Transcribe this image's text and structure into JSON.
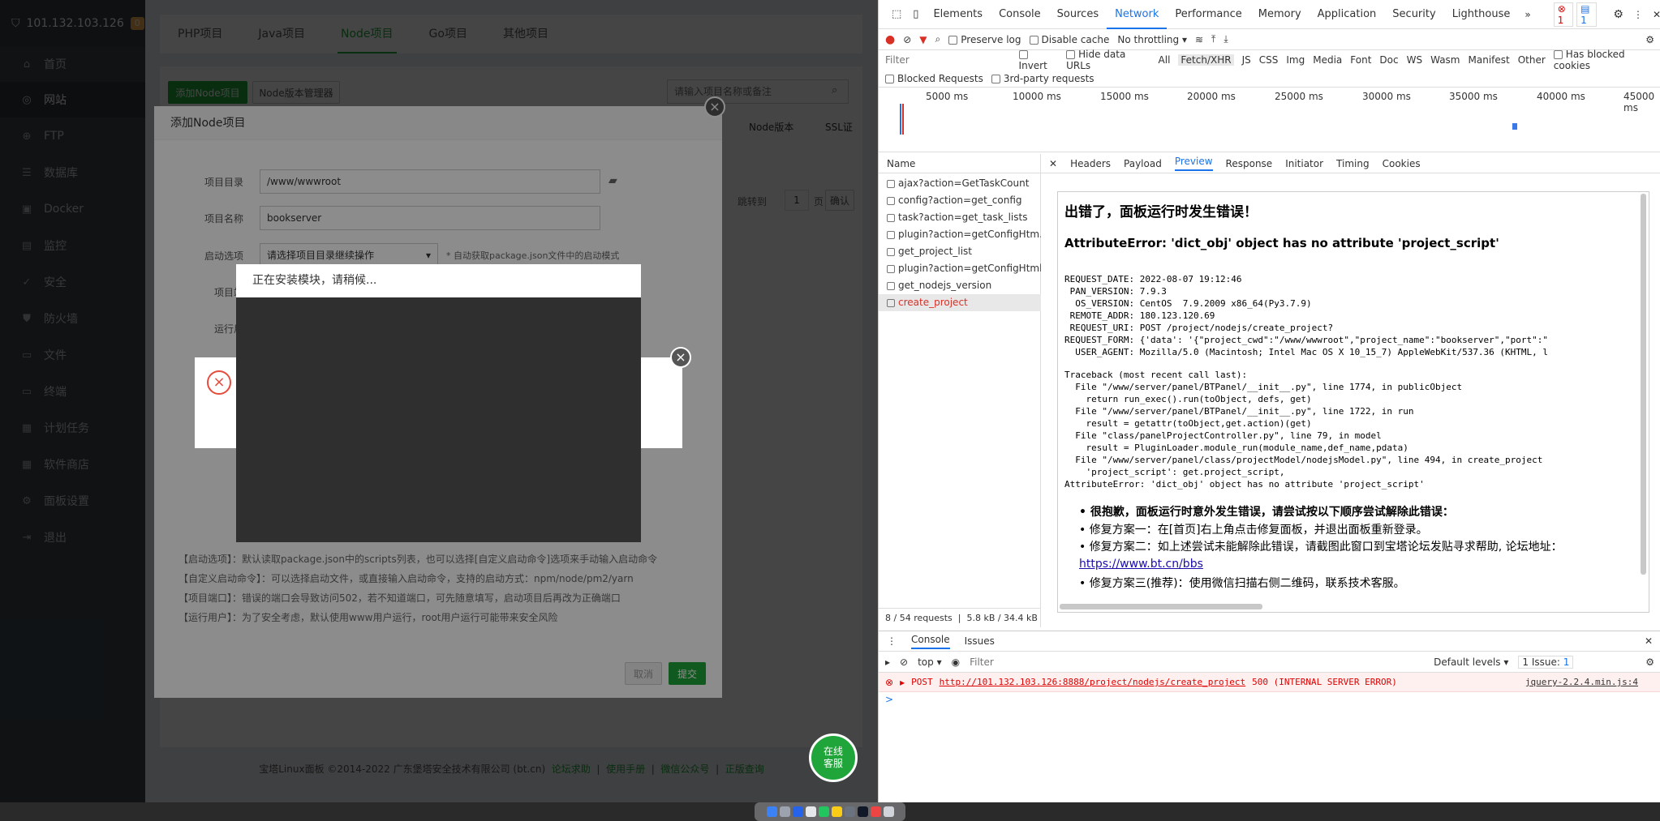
{
  "sidebar": {
    "server_ip": "101.132.103.126",
    "badge_count": "0",
    "items": [
      {
        "label": "首页",
        "icon": "home-icon"
      },
      {
        "label": "网站",
        "icon": "globe-icon",
        "active": true
      },
      {
        "label": "FTP",
        "icon": "ftp-icon"
      },
      {
        "label": "数据库",
        "icon": "database-icon"
      },
      {
        "label": "Docker",
        "icon": "docker-icon"
      },
      {
        "label": "监控",
        "icon": "monitor-icon"
      },
      {
        "label": "安全",
        "icon": "shield-icon"
      },
      {
        "label": "防火墙",
        "icon": "firewall-icon"
      },
      {
        "label": "文件",
        "icon": "folder-icon"
      },
      {
        "label": "终端",
        "icon": "terminal-icon"
      },
      {
        "label": "计划任务",
        "icon": "calendar-icon"
      },
      {
        "label": "软件商店",
        "icon": "grid-icon"
      },
      {
        "label": "面板设置",
        "icon": "settings-icon"
      },
      {
        "label": "退出",
        "icon": "logout-icon"
      }
    ]
  },
  "project_tabs": [
    "PHP项目",
    "Java项目",
    "Node项目",
    "Go项目",
    "其他项目"
  ],
  "toolbar": {
    "add_node": "添加Node项目",
    "node_version_mgr": "Node版本管理器",
    "search_placeholder": "请输入项目名称或备注"
  },
  "table_headers": {
    "node_version": "Node版本",
    "ssl": "SSL证"
  },
  "pagination": {
    "jump_to": "跳转到",
    "page_num": "1",
    "page_unit": "页",
    "confirm": "确认"
  },
  "dialog": {
    "title": "添加Node项目",
    "fields": {
      "dir_label": "项目目录",
      "dir_value": "/www/wwwroot",
      "name_label": "项目名称",
      "name_value": "bookserver",
      "start_label": "启动选项",
      "start_value": "请选择项目目录继续操作",
      "start_hint": "* 自动获取package.json文件中的启动模式",
      "port_label": "项目端",
      "user_label": "运行用"
    },
    "hints": [
      "【启动选项】：默认读取package.json中的scripts列表，也可以选择[自定义启动命令]选项来手动输入启动命令",
      "【自定义启动命令】：可以选择启动文件，或直接输入启动命令，支持的启动方式：npm/node/pm2/yarn",
      "【项目端口】：错误的端口会导致访问502，若不知道端口，可先随意填写，启动项目后再改为正确端口",
      "【运行用户】：为了安全考虑，默认使用www用户运行，root用户运行可能带来安全风险"
    ],
    "cancel": "取消",
    "submit": "提交"
  },
  "loader": {
    "message": "正在安装模块，请稍候..."
  },
  "chat_button": "在线\n客服",
  "footer": {
    "copyright": "宝塔Linux面板 ©2014-2022 广东堡塔安全技术有限公司 (bt.cn)",
    "links": [
      "论坛求助",
      "使用手册",
      "微信公众号",
      "正版查询"
    ]
  },
  "devtools": {
    "tabs": [
      "Elements",
      "Console",
      "Sources",
      "Network",
      "Performance",
      "Memory",
      "Application",
      "Security",
      "Lighthouse"
    ],
    "active_tab": "Network",
    "error_badge": "1",
    "info_badge": "1",
    "toolbar": {
      "preserve_log": "Preserve log",
      "disable_cache": "Disable cache",
      "throttling": "No throttling"
    },
    "filter_placeholder": "Filter",
    "filter_types": [
      "Invert",
      "Hide data URLs",
      "All",
      "Fetch/XHR",
      "JS",
      "CSS",
      "Img",
      "Media",
      "Font",
      "Doc",
      "WS",
      "Wasm",
      "Manifest",
      "Other",
      "Has blocked cookies"
    ],
    "blocked_requests": "Blocked Requests",
    "third_party": "3rd-party requests",
    "timeline_ticks": [
      "5000 ms",
      "10000 ms",
      "15000 ms",
      "20000 ms",
      "25000 ms",
      "30000 ms",
      "35000 ms",
      "40000 ms",
      "45000 ms"
    ],
    "name_header": "Name",
    "requests": [
      "ajax?action=GetTaskCount",
      "config?action=get_config",
      "task?action=get_task_lists",
      "plugin?action=getConfigHtm...",
      "get_project_list",
      "plugin?action=getConfigHtml",
      "get_nodejs_version",
      "create_project"
    ],
    "detail_tabs": [
      "Headers",
      "Payload",
      "Preview",
      "Response",
      "Initiator",
      "Timing",
      "Cookies"
    ],
    "active_detail": "Preview",
    "summary_requests": "8 / 54 requests",
    "summary_size": "5.8 kB / 34.4 kB"
  },
  "preview": {
    "title": "出错了，面板运行时发生错误！",
    "error": "AttributeError: 'dict_obj' object has no attribute 'project_script'",
    "details": "REQUEST_DATE: 2022-08-07 19:12:46\n PAN_VERSION: 7.9.3\n  OS_VERSION: CentOS  7.9.2009 x86_64(Py3.7.9)\n REMOTE_ADDR: 180.123.120.69\n REQUEST_URI: POST /project/nodejs/create_project?\nREQUEST_FORM: {'data': '{\"project_cwd\":\"/www/wwwroot\",\"project_name\":\"bookserver\",\"port\":\"\n  USER_AGENT: Mozilla/5.0 (Macintosh; Intel Mac OS X 10_15_7) AppleWebKit/537.36 (KHTML, l",
    "traceback": "Traceback (most recent call last):\n  File \"/www/server/panel/BTPanel/__init__.py\", line 1774, in publicObject\n    return run_exec().run(toObject, defs, get)\n  File \"/www/server/panel/BTPanel/__init__.py\", line 1722, in run\n    result = getattr(toObject,get.action)(get)\n  File \"class/panelProjectController.py\", line 79, in model\n    result = PluginLoader.module_run(module_name,def_name,pdata)\n  File \"/www/server/panel/class/projectModel/nodejsModel.py\", line 494, in create_project\n    'project_script': get.project_script,\nAttributeError: 'dict_obj' object has no attribute 'project_script'",
    "sorry": "很抱歉，面板运行时意外发生错误，请尝试按以下顺序尝试解除此错误：",
    "fix1": "修复方案一：在[首页]右上角点击修复面板，并退出面板重新登录。",
    "fix2": "修复方案二：如上述尝试未能解除此错误，请截图此窗口到宝塔论坛发贴寻求帮助, 论坛地址：",
    "fix2_link": "https://www.bt.cn/bbs",
    "fix3": "修复方案三(推荐)：使用微信扫描右侧二维码，联系技术客服。"
  },
  "console": {
    "tabs": [
      "Console",
      "Issues"
    ],
    "context": "top",
    "filter_placeholder": "Filter",
    "levels": "Default levels",
    "issues": "1 Issue:",
    "issues_count": "1",
    "error_method": "POST",
    "error_url": "http://101.132.103.126:8888/project/nodejs/create_project",
    "error_status": "500 (INTERNAL SERVER ERROR)",
    "error_source": "jquery-2.2.4.min.js:4",
    "prompt": ">"
  }
}
